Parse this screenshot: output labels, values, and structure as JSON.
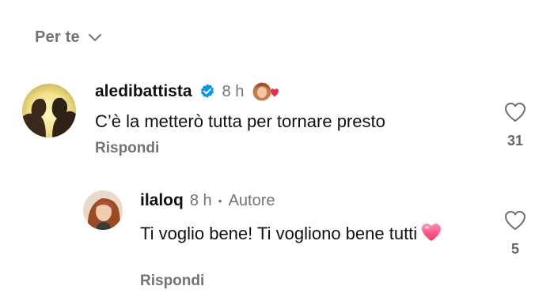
{
  "sort": {
    "label": "Per te"
  },
  "comments": [
    {
      "username": "aledibattista",
      "time": "8 h",
      "text": "C’è la metterò tutta per tornare presto",
      "reply_label": "Rispondi",
      "likes": "31",
      "verified": true
    }
  ],
  "replies": [
    {
      "username": "ilaloq",
      "time": "8 h",
      "separator": "•",
      "author_tag": "Autore",
      "text": "Ti voglio bene! Ti vogliono bene tutti",
      "reply_label": "Rispondi",
      "likes": "5"
    }
  ],
  "colors": {
    "verified_blue": "#0095f6",
    "heart_red": "#ed2b48",
    "emoji_pink": "#ff4d7a",
    "meta_gray": "#737373"
  },
  "icons": {
    "sort": "chevron-down-icon",
    "verified": "verified-badge-icon",
    "like": "heart-outline-icon",
    "emoji": "pink-heart-emoji",
    "liked_by_author": "author-liked-icon"
  }
}
